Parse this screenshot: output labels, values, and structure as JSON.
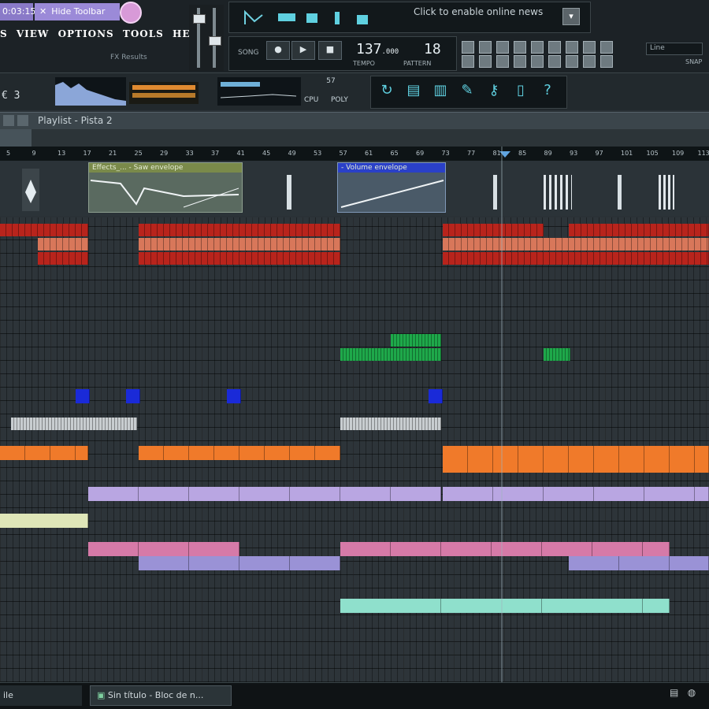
{
  "window": {
    "tabs": [
      {
        "label": "0:03:15"
      },
      {
        "label": "Hide Toolbar",
        "close_icon": "x-icon"
      }
    ],
    "logo_icon": "fl-fruit-logo-icon"
  },
  "menubar": {
    "items": [
      "S",
      "VIEW",
      "OPTIONS",
      "TOOLS",
      "HELP"
    ],
    "fx_label": "FX Results"
  },
  "hint": {
    "text": "Click to enable online news",
    "button_icon": "chevron-down-icon"
  },
  "transport": {
    "song_label": "SONG",
    "tempo_value": "137",
    "tempo_decimals": ".000",
    "tempo_label": "TEMPO",
    "pattern_value": "18",
    "pattern_label": "PATTERN",
    "buttons": [
      "pattern-song-toggle",
      "play",
      "stop",
      "record"
    ]
  },
  "snap": {
    "value": "Line",
    "label": "SNAP"
  },
  "monitor": {
    "cpu_label": "€ 3",
    "readout_top": "57",
    "readout_left": "CPU",
    "readout_right": "POLY"
  },
  "icons": [
    "refresh-icon",
    "plugin-icon",
    "mixer-icon",
    "brush-icon",
    "key-icon",
    "document-icon",
    "help-icon"
  ],
  "playlist": {
    "title": "Playlist - Pista 2",
    "ruler": [
      "5",
      "9",
      "13",
      "17",
      "21",
      "25",
      "29",
      "33",
      "37",
      "41",
      "45",
      "49",
      "53",
      "57",
      "61",
      "65",
      "69",
      "73",
      "77",
      "81",
      "85",
      "89",
      "93",
      "97",
      "101",
      "105",
      "109",
      "113"
    ],
    "automation_clips": [
      {
        "label": "Effects_... - Saw envelope"
      },
      {
        "label": "- Volume envelope"
      }
    ]
  },
  "colors": {
    "red": "#b8241c",
    "salmon": "#d8775a",
    "green": "#1ea84a",
    "blue": "#1a2ad8",
    "gray": "#c8cdd0",
    "orange": "#f07a2a",
    "lavender": "#b9a6e2",
    "cream": "#dfe6b8",
    "pink": "#d67aa8",
    "periwinkle": "#9a92d6",
    "teal": "#8fe0cc"
  },
  "taskbar": {
    "items": [
      {
        "label": "ile"
      },
      {
        "label": "Sin título - Bloc de n..."
      }
    ]
  }
}
